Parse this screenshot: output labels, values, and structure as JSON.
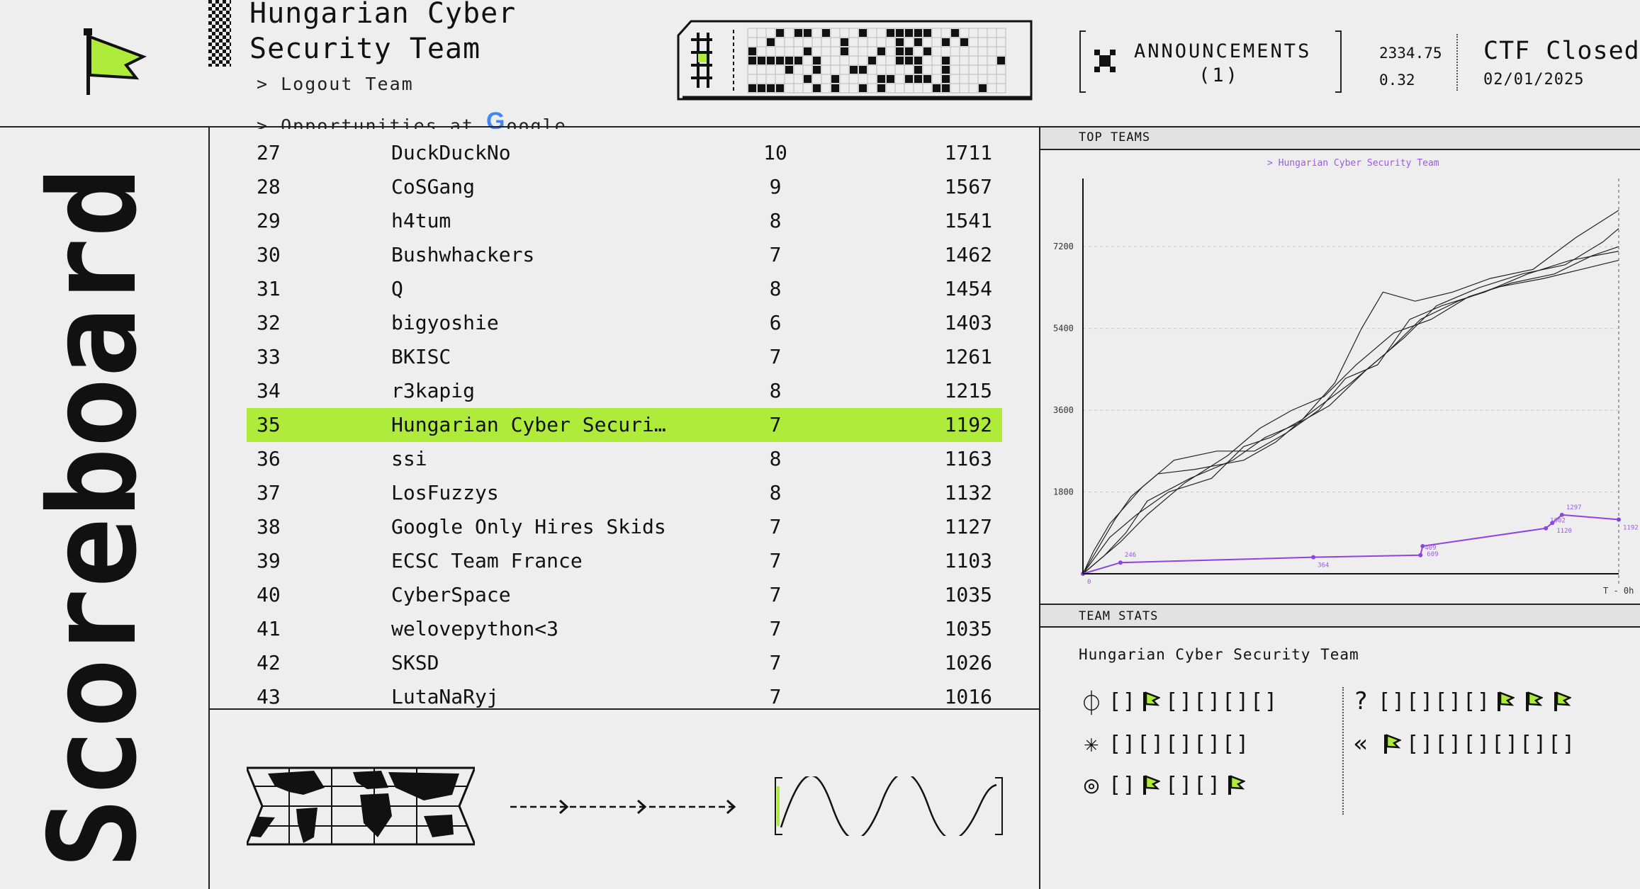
{
  "header": {
    "team_title": "Hungarian Cyber Security Team",
    "logout_label": "> Logout Team",
    "opps_prefix": "> Opportunities at ",
    "opps_brand_g": "G",
    "opps_brand_rest": "oogle",
    "announcements_label": "ANNOUNCEMENTS",
    "announcements_count": "(1)",
    "stat_top": "2334.75",
    "stat_bottom": "0.32",
    "ctf_status": "CTF Closed",
    "ctf_date": "02/01/2025"
  },
  "sidebar": {
    "page_title": "Scoreboard"
  },
  "scoreboard": {
    "rows": [
      {
        "rank": "27",
        "name": "DuckDuckNo",
        "solves": "10",
        "score": "1711",
        "highlight": false
      },
      {
        "rank": "28",
        "name": "CoSGang",
        "solves": "9",
        "score": "1567",
        "highlight": false
      },
      {
        "rank": "29",
        "name": "h4tum",
        "solves": "8",
        "score": "1541",
        "highlight": false
      },
      {
        "rank": "30",
        "name": "Bushwhackers",
        "solves": "7",
        "score": "1462",
        "highlight": false
      },
      {
        "rank": "31",
        "name": "Q",
        "solves": "8",
        "score": "1454",
        "highlight": false
      },
      {
        "rank": "32",
        "name": "bigyoshie",
        "solves": "6",
        "score": "1403",
        "highlight": false
      },
      {
        "rank": "33",
        "name": "BKISC",
        "solves": "7",
        "score": "1261",
        "highlight": false
      },
      {
        "rank": "34",
        "name": "r3kapig",
        "solves": "8",
        "score": "1215",
        "highlight": false
      },
      {
        "rank": "35",
        "name": "Hungarian Cyber Securi…",
        "solves": "7",
        "score": "1192",
        "highlight": true
      },
      {
        "rank": "36",
        "name": "ssi",
        "solves": "8",
        "score": "1163",
        "highlight": false
      },
      {
        "rank": "37",
        "name": "LosFuzzys",
        "solves": "8",
        "score": "1132",
        "highlight": false
      },
      {
        "rank": "38",
        "name": "Google Only Hires Skids",
        "solves": "7",
        "score": "1127",
        "highlight": false
      },
      {
        "rank": "39",
        "name": "ECSC Team France",
        "solves": "7",
        "score": "1103",
        "highlight": false
      },
      {
        "rank": "40",
        "name": "CyberSpace",
        "solves": "7",
        "score": "1035",
        "highlight": false
      },
      {
        "rank": "41",
        "name": "welovepython<3",
        "solves": "7",
        "score": "1035",
        "highlight": false
      },
      {
        "rank": "42",
        "name": "SKSD",
        "solves": "7",
        "score": "1026",
        "highlight": false
      },
      {
        "rank": "43",
        "name": "LutaNaRyj",
        "solves": "7",
        "score": "1016",
        "highlight": false
      }
    ]
  },
  "top_teams": {
    "header": "TOP TEAMS",
    "legend": "> Hungarian Cyber Security Team",
    "y_ticks": [
      "7200",
      "5400",
      "3600",
      "1800"
    ],
    "x_end_label": "T - 0h",
    "colors": {
      "team_line": "#8e44e0",
      "others": "#222222",
      "accent": "#afeb3a"
    }
  },
  "chart_data": {
    "type": "line",
    "title": "",
    "xlabel": "",
    "ylabel": "",
    "ylim": [
      0,
      8700
    ],
    "x_end_label": "T - 0h",
    "series": [
      {
        "name": "Hungarian Cyber Security Team",
        "x": [
          0,
          0.07,
          0.43,
          0.63,
          0.634,
          0.864,
          0.876,
          0.894,
          1.0
        ],
        "values": [
          0,
          246,
          364,
          409,
          609,
          1002,
          1120,
          1297,
          1192
        ],
        "point_labels": [
          "0",
          "246",
          "364",
          "409",
          "609",
          "1002",
          "1120",
          "1297",
          "1192"
        ]
      },
      {
        "x": [
          0,
          0.03,
          0.06,
          0.09,
          0.14,
          0.21,
          0.3,
          0.36,
          0.42,
          0.5,
          0.57,
          0.63,
          0.7,
          0.77,
          0.86,
          0.93,
          1.0
        ],
        "values": [
          0,
          600,
          1200,
          1700,
          2200,
          2300,
          2500,
          2900,
          3500,
          4200,
          4900,
          5600,
          6000,
          6300,
          6500,
          6700,
          6900
        ]
      },
      {
        "x": [
          0,
          0.04,
          0.08,
          0.12,
          0.2,
          0.28,
          0.34,
          0.4,
          0.46,
          0.53,
          0.6,
          0.66,
          0.74,
          0.82,
          0.9,
          0.97,
          1.0
        ],
        "values": [
          0,
          400,
          900,
          1600,
          2100,
          2500,
          3000,
          3300,
          3700,
          4500,
          5200,
          5900,
          6300,
          6600,
          6800,
          7300,
          7600
        ]
      },
      {
        "x": [
          0,
          0.05,
          0.1,
          0.16,
          0.24,
          0.3,
          0.35,
          0.41,
          0.47,
          0.52,
          0.56,
          0.62,
          0.69,
          0.76,
          0.84,
          0.92,
          1.0
        ],
        "values": [
          0,
          800,
          1300,
          1800,
          2100,
          2800,
          3000,
          3400,
          4200,
          5400,
          6200,
          6000,
          6200,
          6500,
          6700,
          7400,
          8000
        ]
      },
      {
        "x": [
          0,
          0.03,
          0.07,
          0.12,
          0.19,
          0.27,
          0.33,
          0.39,
          0.45,
          0.51,
          0.58,
          0.65,
          0.72,
          0.8,
          0.88,
          0.95,
          1.0
        ],
        "values": [
          0,
          300,
          700,
          1300,
          2000,
          2600,
          3200,
          3600,
          3900,
          4600,
          5300,
          5600,
          6100,
          6400,
          6600,
          7000,
          7200
        ]
      },
      {
        "x": [
          0,
          0.02,
          0.05,
          0.11,
          0.17,
          0.25,
          0.32,
          0.38,
          0.44,
          0.49,
          0.55,
          0.61,
          0.67,
          0.75,
          0.83,
          0.91,
          1.0
        ],
        "values": [
          0,
          500,
          1100,
          1900,
          2500,
          2700,
          2700,
          3100,
          3600,
          4300,
          4600,
          5600,
          5900,
          6200,
          6600,
          6900,
          7100
        ]
      }
    ]
  },
  "team_stats": {
    "header": "TEAM STATS",
    "team_name": "Hungarian Cyber Security Team",
    "empty_slot": "[]",
    "categories": [
      {
        "icon": "phi-icon",
        "glyph": "⏀",
        "slots": [
          "empty",
          "flag",
          "empty",
          "empty",
          "empty",
          "empty"
        ]
      },
      {
        "icon": "asterisk-icon",
        "glyph": "✳",
        "slots": [
          "empty",
          "empty",
          "empty",
          "empty",
          "empty"
        ]
      },
      {
        "icon": "spiral-icon",
        "glyph": "◎",
        "slots": [
          "empty",
          "flag",
          "empty",
          "empty",
          "flag"
        ]
      },
      {
        "icon": "question-icon",
        "glyph": "?",
        "slots": [
          "empty",
          "empty",
          "empty",
          "empty",
          "flag",
          "flag",
          "flag"
        ]
      },
      {
        "icon": "double-chevron-left-icon",
        "glyph": "«",
        "slots": [
          "flag",
          "empty",
          "empty",
          "empty",
          "empty",
          "empty",
          "empty"
        ]
      }
    ]
  }
}
